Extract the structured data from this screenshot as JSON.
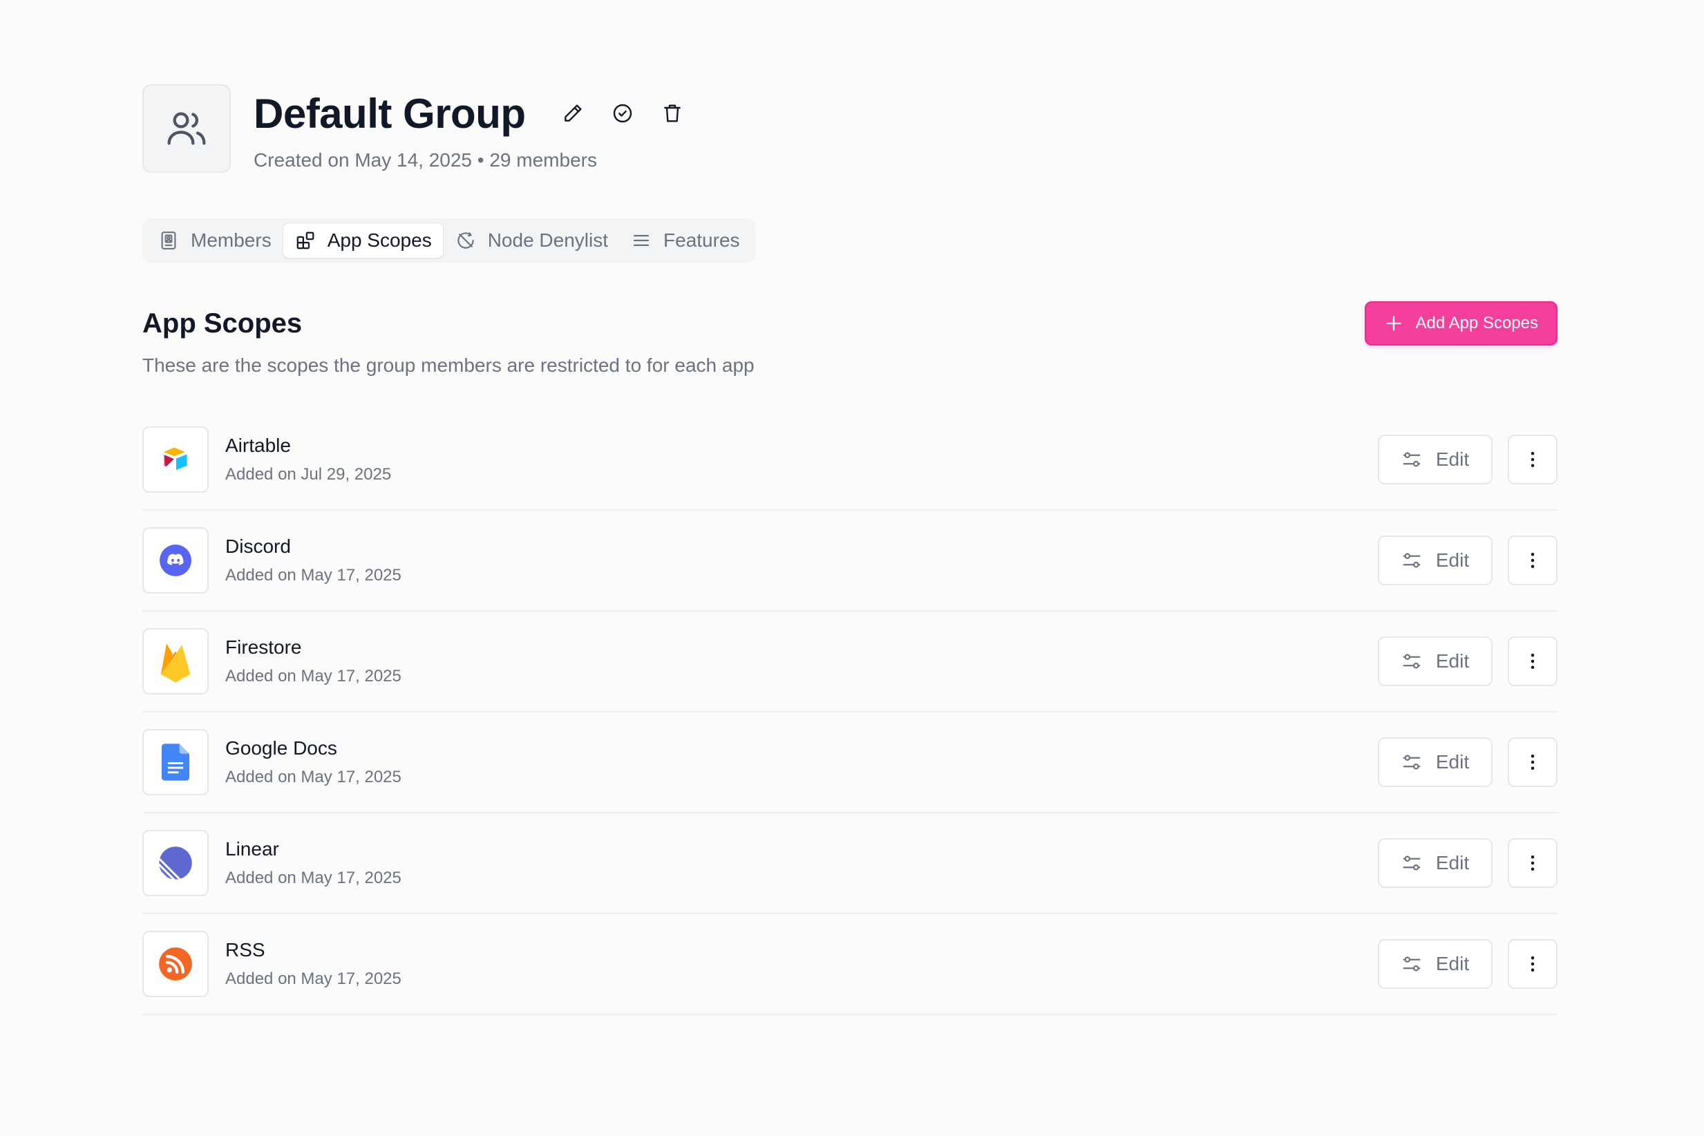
{
  "header": {
    "title": "Default Group",
    "subtitle": "Created on May 14, 2025 • 29 members",
    "avatar_icon": "users-icon",
    "actions": [
      "pencil-icon",
      "check-circle-icon",
      "trash-icon"
    ]
  },
  "tabs": [
    {
      "label": "Members",
      "icon": "contact-icon",
      "active": false
    },
    {
      "label": "App Scopes",
      "icon": "blocks-icon",
      "active": true
    },
    {
      "label": "Node Denylist",
      "icon": "blocked-icon",
      "active": false
    },
    {
      "label": "Features",
      "icon": "menu-icon",
      "active": false
    }
  ],
  "section": {
    "title": "App Scopes",
    "description": "These are the scopes the group members are restricted to for each app",
    "add_button_label": "Add App Scopes"
  },
  "apps": [
    {
      "name": "Airtable",
      "date": "Added on Jul 29, 2025",
      "icon": "airtable-icon",
      "edit_label": "Edit"
    },
    {
      "name": "Discord",
      "date": "Added on May 17, 2025",
      "icon": "discord-icon",
      "edit_label": "Edit"
    },
    {
      "name": "Firestore",
      "date": "Added on May 17, 2025",
      "icon": "firestore-icon",
      "edit_label": "Edit"
    },
    {
      "name": "Google Docs",
      "date": "Added on May 17, 2025",
      "icon": "google-docs-icon",
      "edit_label": "Edit"
    },
    {
      "name": "Linear",
      "date": "Added on May 17, 2025",
      "icon": "linear-icon",
      "edit_label": "Edit"
    },
    {
      "name": "RSS",
      "date": "Added on May 17, 2025",
      "icon": "rss-icon",
      "edit_label": "Edit"
    }
  ],
  "colors": {
    "accent": "#f43f9c",
    "discord": "#5865f2",
    "linear": "#5e6ad2",
    "rss": "#f26522",
    "google_docs": "#4285f4"
  }
}
